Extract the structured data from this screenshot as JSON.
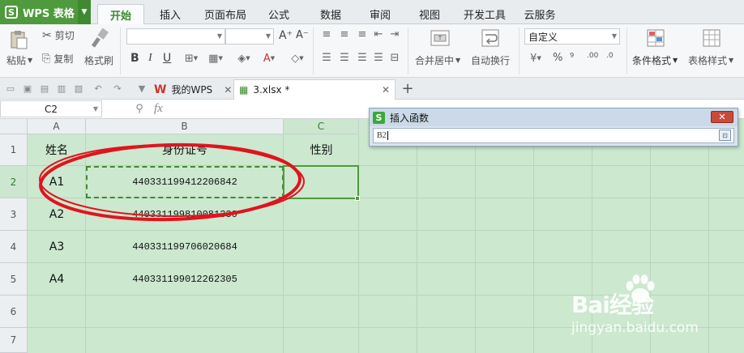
{
  "app": {
    "name": "WPS 表格"
  },
  "menu": {
    "tabs": [
      "开始",
      "插入",
      "页面布局",
      "公式",
      "数据",
      "审阅",
      "视图",
      "开发工具",
      "云服务"
    ],
    "active": "开始"
  },
  "ribbon": {
    "paste_label": "粘贴",
    "cut_label": "剪切",
    "copy_label": "复制",
    "format_painter_label": "格式刷",
    "bold": "B",
    "italic": "I",
    "underline": "U",
    "font_grow": "A⁺",
    "font_shrink": "A⁻",
    "merge_center_label": "合并居中",
    "wrap_text_label": "自动换行",
    "number_format_value": "自定义",
    "percent": "%",
    "comma": "⁹",
    "inc_decimal": ".00",
    "dec_decimal": ".0",
    "conditional_format_label": "条件格式",
    "table_style_label": "表格样式"
  },
  "doc_tabs": [
    {
      "label": "我的WPS"
    },
    {
      "label": "3.xlsx *"
    }
  ],
  "formula_bar": {
    "cell_ref": "C2",
    "fx": "fx"
  },
  "sheet": {
    "columns": [
      "A",
      "B",
      "C"
    ],
    "rows": [
      "1",
      "2",
      "3",
      "4",
      "5",
      "6",
      "7"
    ],
    "header": {
      "a": "姓名",
      "b": "身份证号",
      "c": "性别"
    },
    "data": [
      {
        "name": "A1",
        "id": "440331199412206842"
      },
      {
        "name": "A2",
        "id": "440331199810081330"
      },
      {
        "name": "A3",
        "id": "440331199706020684"
      },
      {
        "name": "A4",
        "id": "440331199012262305"
      }
    ]
  },
  "dialog": {
    "title": "插入函数",
    "input_value": "B2",
    "close_icon": "close-icon"
  },
  "watermark": {
    "brand": "Bai经验",
    "url": "jingyan.baidu.com"
  },
  "colors": {
    "accent": "#4e9a3c",
    "sheet_bg": "#cce8cf",
    "annotation": "#e0141e"
  }
}
